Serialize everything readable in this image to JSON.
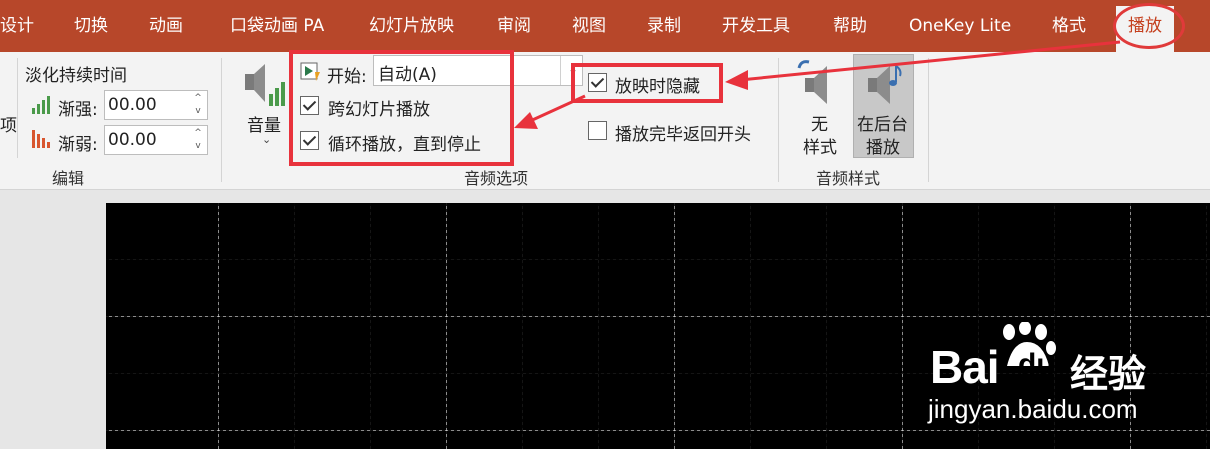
{
  "tabs": [
    "设计",
    "切换",
    "动画",
    "口袋动画 PA",
    "幻灯片放映",
    "审阅",
    "视图",
    "录制",
    "开发工具",
    "帮助",
    "OneKey Lite",
    "格式",
    "播放"
  ],
  "active_tab": "播放",
  "edit_group": {
    "fade_title": "淡化持续时间",
    "fade_in_label": "渐强:",
    "fade_in_value": "00.00",
    "fade_out_label": "渐弱:",
    "fade_out_value": "00.00",
    "left_clip_char": "项",
    "group_label": "编辑"
  },
  "audio_options": {
    "volume_label": "音量",
    "start_label": "开始:",
    "start_value": "自动(A)",
    "play_across_slides": {
      "label": "跨幻灯片播放",
      "checked": true
    },
    "loop_until_stopped": {
      "label": "循环播放，直到停止",
      "checked": true
    },
    "hide_during_show": {
      "label": "放映时隐藏",
      "checked": true
    },
    "rewind_after_playing": {
      "label": "播放完毕返回开头",
      "checked": false
    },
    "group_label": "音频选项"
  },
  "audio_styles": {
    "no_style_line1": "无",
    "no_style_line2": "样式",
    "bg_play_line1": "在后台",
    "bg_play_line2": "播放",
    "group_label": "音频样式"
  },
  "watermark": {
    "brand_left": "Bai",
    "brand_right": "du",
    "brand_cn": "经验",
    "url": "jingyan.baidu.com"
  },
  "colors": {
    "tab_bar": "#b7472a",
    "highlight_red": "#e8323c",
    "slide_bg": "#000000"
  }
}
